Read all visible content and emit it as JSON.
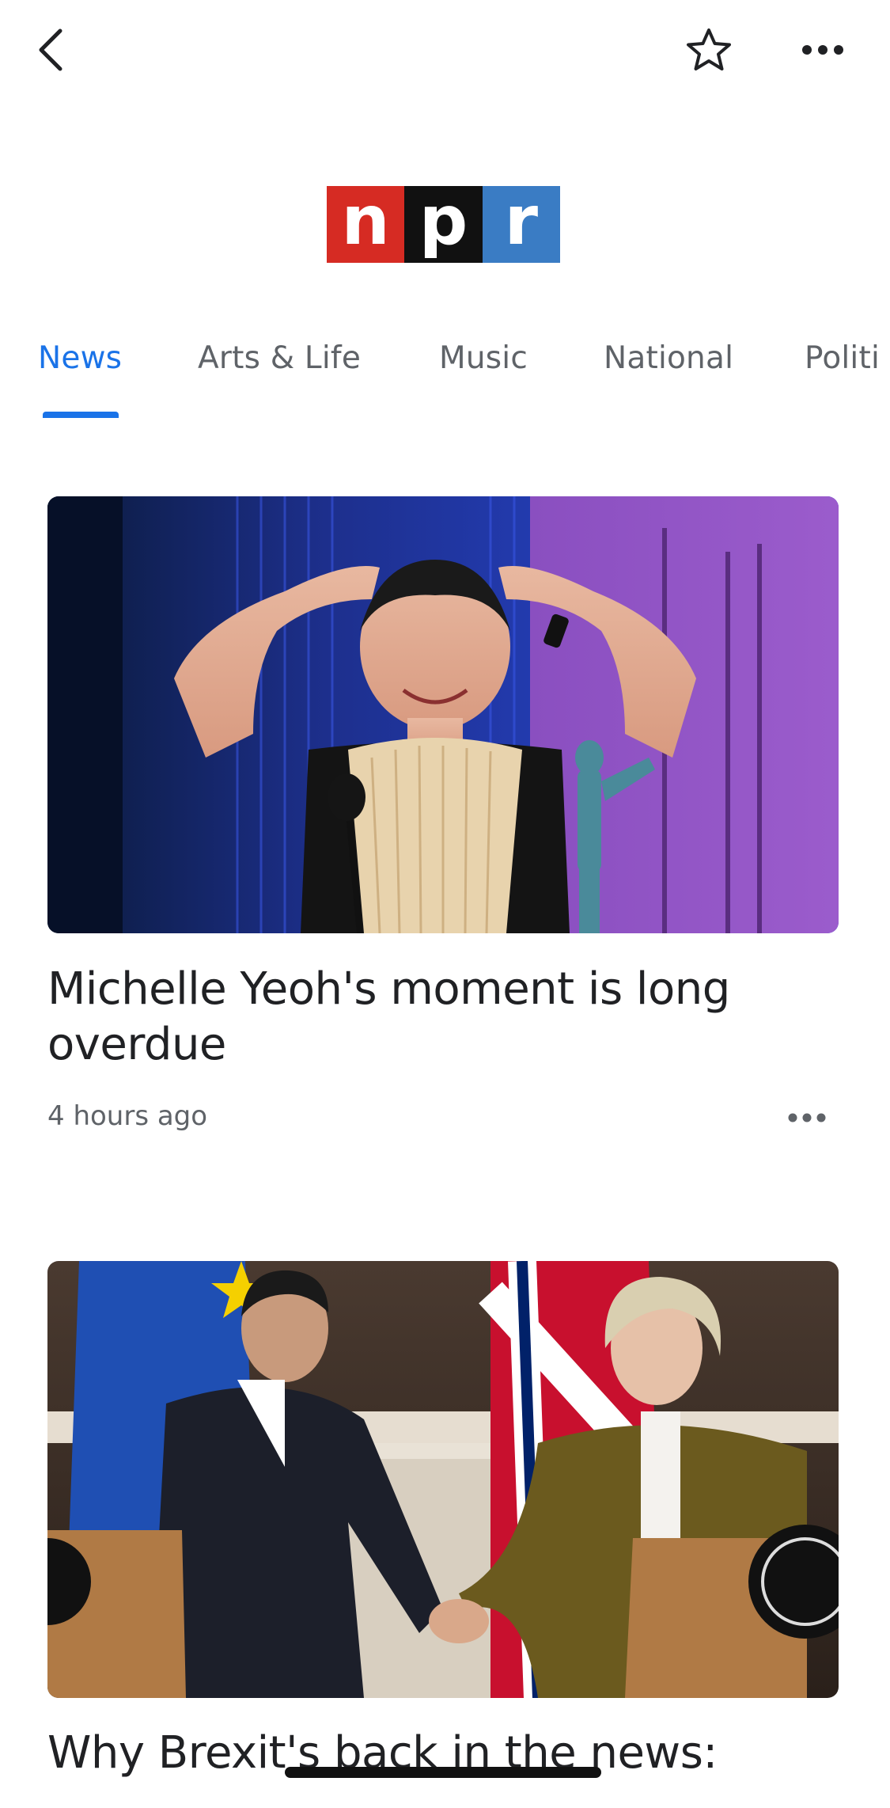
{
  "header": {
    "back_icon": "chevron-left-icon",
    "favorite_icon": "star-outline-icon",
    "more_icon": "more-horizontal-icon"
  },
  "publisher": {
    "logo_letters": [
      "n",
      "p",
      "r"
    ],
    "logo_colors": [
      "#d62b23",
      "#111111",
      "#3a7cc4"
    ]
  },
  "tabs": [
    {
      "label": "News",
      "active": true
    },
    {
      "label": "Arts & Life",
      "active": false
    },
    {
      "label": "Music",
      "active": false
    },
    {
      "label": "National",
      "active": false
    },
    {
      "label": "Politi",
      "active": false
    }
  ],
  "articles": [
    {
      "headline": "Michelle Yeoh's moment is long overdue",
      "timestamp": "4 hours ago",
      "more_icon": "more-horizontal-icon"
    },
    {
      "headline": "Why Brexit's back in the news:"
    }
  ],
  "colors": {
    "accent": "#1a73e8",
    "text_primary": "#202124",
    "text_secondary": "#5f6368"
  }
}
